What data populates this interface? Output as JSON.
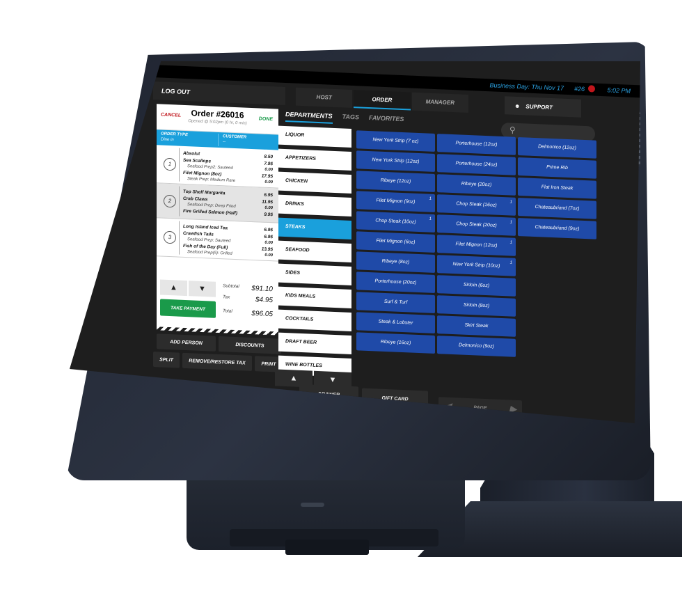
{
  "status_bar": {
    "business_day": "Business Day: Thu Nov 17",
    "terminal": "#26",
    "time": "5:02 PM"
  },
  "header": {
    "logout_label": "LOG OUT",
    "tabs": [
      {
        "label": "HOST",
        "active": false
      },
      {
        "label": "ORDER",
        "active": true
      },
      {
        "label": "MANAGER",
        "active": false
      }
    ],
    "support_label": "SUPPORT"
  },
  "ticket": {
    "cancel_label": "CANCEL",
    "done_label": "DONE",
    "order_number": "Order #26016",
    "opened": "Opened @ 5:02pm (0 hr, 0 min)",
    "order_type_label": "ORDER TYPE",
    "order_type_value": "Dine in",
    "customer_label": "CUSTOMER",
    "customer_value": "--",
    "seats": [
      {
        "number": "1",
        "items": [
          {
            "name": "Absolut",
            "price": "8.50"
          },
          {
            "name": "Sea Scallops",
            "price": "7.95",
            "modifier": "Seafood Prep2: Sauteed",
            "modifier_price": "0.00"
          },
          {
            "name": "Filet Mignon (8oz)",
            "price": "17.95",
            "modifier": "Steak Prep: Medium Rare",
            "modifier_price": "0.00"
          }
        ]
      },
      {
        "number": "2",
        "items": [
          {
            "name": "Top Shelf Margarita",
            "price": "6.95"
          },
          {
            "name": "Crab Claws",
            "price": "11.95",
            "modifier": "Seafood Prep: Deep Fried",
            "modifier_price": "0.00"
          },
          {
            "name": "Fire Grilled Salmon (Half)",
            "price": "9.95"
          }
        ]
      },
      {
        "number": "3",
        "items": [
          {
            "name": "Long Island Iced Tea",
            "price": "6.95"
          },
          {
            "name": "Crawfish Tails",
            "price": "6.95",
            "modifier": "Seafood Prep: Sauteed",
            "modifier_price": "0.00"
          },
          {
            "name": "Fish of the Day (Full)",
            "price": "13.95",
            "modifier": "Seafood Prep(5): Grilled",
            "modifier_price": "0.00"
          }
        ]
      }
    ],
    "subtotal_label": "Subtotal",
    "subtotal": "$91.10",
    "tax_label": "Tax",
    "tax": "$4.95",
    "total_label": "Total",
    "total": "$96.05",
    "take_payment_label": "TAKE PAYMENT"
  },
  "ticket_actions": {
    "add_person": "ADD PERSON",
    "discounts": "DISCOUNTS",
    "split": "SPLIT",
    "remove_restore_tax": "REMOVE/RESTORE TAX",
    "print": "PRINT"
  },
  "menu": {
    "subtabs": [
      {
        "label": "DEPARTMENTS",
        "active": true
      },
      {
        "label": "TAGS",
        "active": false
      },
      {
        "label": "FAVORITES",
        "active": false
      }
    ],
    "search_placeholder": "",
    "departments": [
      {
        "label": "LIQUOR",
        "active": false
      },
      {
        "label": "APPETIZERS",
        "active": false
      },
      {
        "label": "CHICKEN",
        "active": false
      },
      {
        "label": "DRINKS",
        "active": false
      },
      {
        "label": "STEAKS",
        "active": true
      },
      {
        "label": "SEAFOOD",
        "active": false
      },
      {
        "label": "SIDES",
        "active": false
      },
      {
        "label": "KIDS MEALS",
        "active": false
      },
      {
        "label": "COCKTAILS",
        "active": false
      },
      {
        "label": "DRAFT BEER",
        "active": false
      },
      {
        "label": "WINE BOTTLES",
        "active": false
      }
    ],
    "items": [
      {
        "label": "New York Strip (7 oz)",
        "count": ""
      },
      {
        "label": "New York Strip (12oz)",
        "count": ""
      },
      {
        "label": "Ribeye (12oz)",
        "count": ""
      },
      {
        "label": "Filet Mignon (9oz)",
        "count": "1"
      },
      {
        "label": "Chop Steak (10oz)",
        "count": "1"
      },
      {
        "label": "Filet Mignon (6oz)",
        "count": ""
      },
      {
        "label": "Ribeye (8oz)",
        "count": ""
      },
      {
        "label": "Porterhouse (20oz)",
        "count": ""
      },
      {
        "label": "Surf & Turf",
        "count": ""
      },
      {
        "label": "Steak & Lobster",
        "count": ""
      },
      {
        "label": "Ribeye (16oz)",
        "count": ""
      },
      {
        "label": "Porterhouse (12oz)",
        "count": ""
      },
      {
        "label": "Porterhouse (24oz)",
        "count": ""
      },
      {
        "label": "Ribeye (20oz)",
        "count": ""
      },
      {
        "label": "Chop Steak (16oz)",
        "count": "1"
      },
      {
        "label": "Chop Steak (20oz)",
        "count": "1"
      },
      {
        "label": "Filet Mignon (12oz)",
        "count": "1"
      },
      {
        "label": "New York Strip (10oz)",
        "count": "1"
      },
      {
        "label": "Sirloin (6oz)",
        "count": ""
      },
      {
        "label": "Sirloin (8oz)",
        "count": ""
      },
      {
        "label": "Skirt Steak",
        "count": ""
      },
      {
        "label": "Delmonico (9oz)",
        "count": ""
      },
      {
        "label": "Delmonico (12oz)",
        "count": ""
      },
      {
        "label": "Prime Rib",
        "count": ""
      },
      {
        "label": "Flat Iron Steak",
        "count": ""
      },
      {
        "label": "Chateaubriand (7oz)",
        "count": ""
      },
      {
        "label": "Chateaubriand (9oz)",
        "count": ""
      }
    ]
  },
  "footer": {
    "drawer_label": "DRAWER",
    "gift_card_label": "GIFT CARD",
    "page_label": "PAGE"
  },
  "colors": {
    "accent_blue": "#1aa0dc",
    "item_blue": "#1f4aa8",
    "take_payment_green": "#1a9a4a",
    "cancel_red": "#c0151b"
  }
}
